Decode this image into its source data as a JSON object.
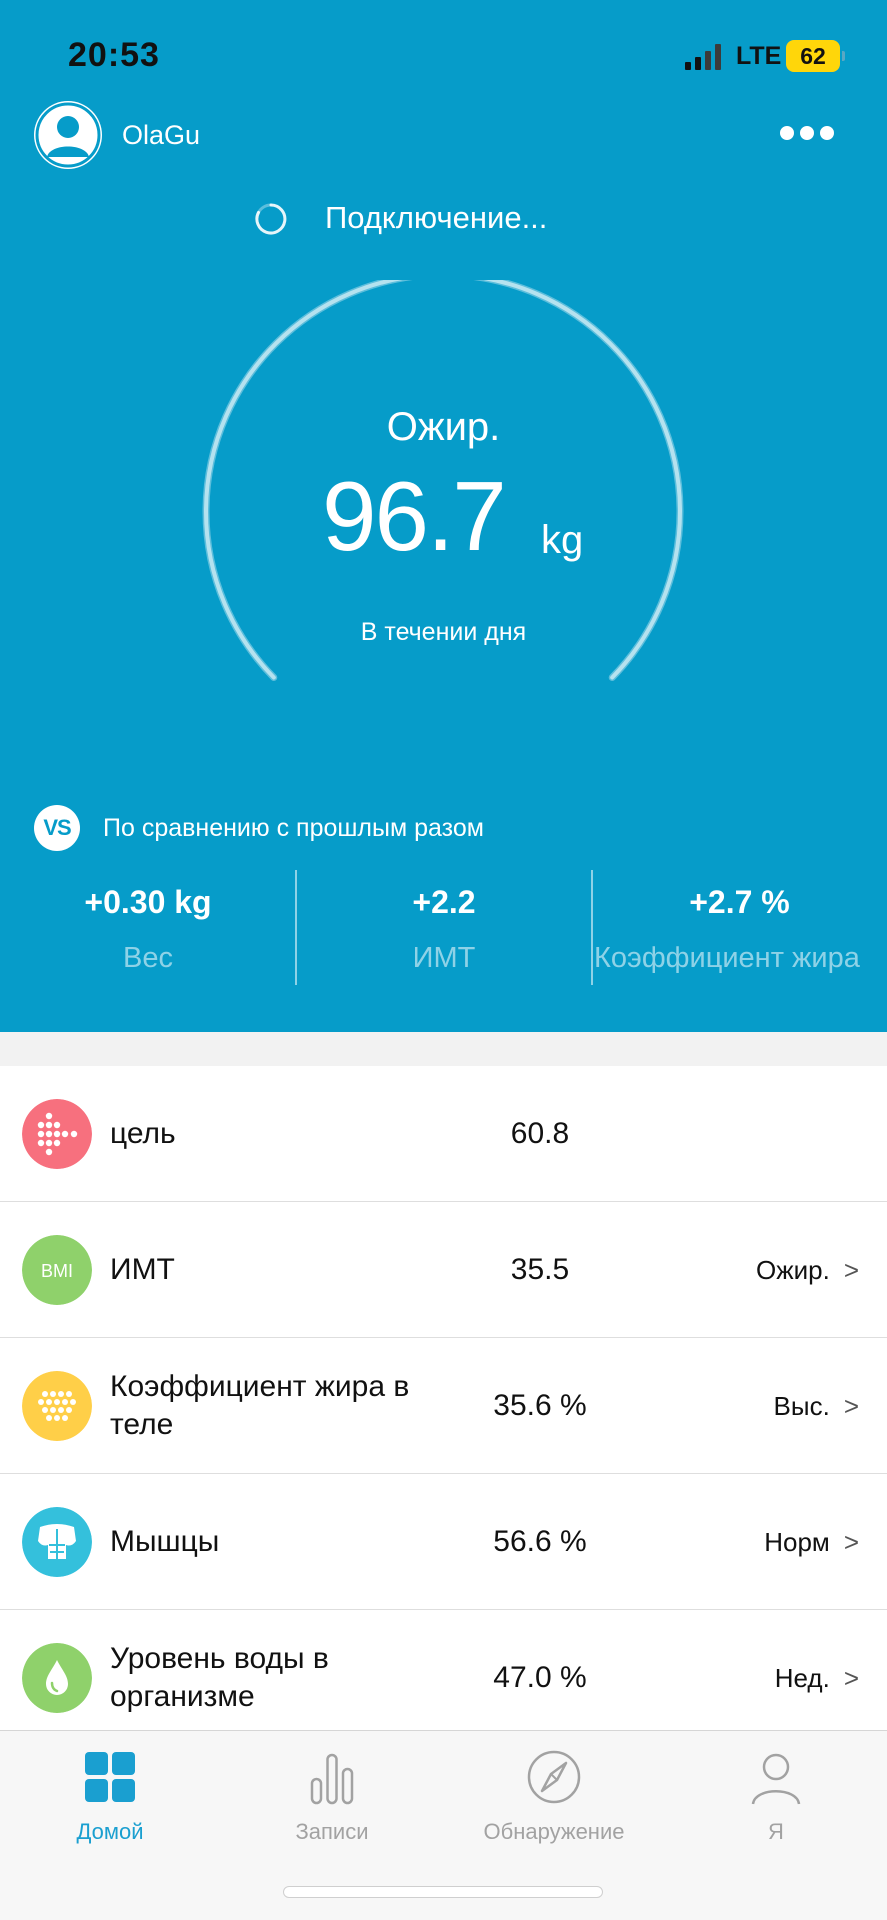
{
  "status_bar": {
    "time": "20:53",
    "network": "LTE",
    "battery": "62"
  },
  "header": {
    "username": "OlaGu",
    "connection_status": "Подключение..."
  },
  "gauge": {
    "status": "Ожир.",
    "value": "96.7",
    "unit": "kg",
    "period": "В течении дня"
  },
  "comparison": {
    "label": "По сравнению с прошлым разом",
    "badge": "VS",
    "items": [
      {
        "value": "+0.30 kg",
        "label": "Вес"
      },
      {
        "value": "+2.2",
        "label": "ИМТ"
      },
      {
        "value": "+2.7 %",
        "label": "Коэффициент жира"
      }
    ]
  },
  "metrics": [
    {
      "name": "цель",
      "value": "60.8",
      "status": "",
      "icon": "goal-icon",
      "color": "#f7707e"
    },
    {
      "name": "ИМТ",
      "value": "35.5",
      "status": "Ожир.",
      "icon": "bmi-icon",
      "icon_text": "BMI",
      "color": "#8fd16b"
    },
    {
      "name": "Коэффициент жира в теле",
      "value": "35.6 %",
      "status": "Выс.",
      "icon": "body-fat-icon",
      "color": "#ffcf48"
    },
    {
      "name": "Мышцы",
      "value": "56.6 %",
      "status": "Норм",
      "icon": "muscle-icon",
      "color": "#34c0dc"
    },
    {
      "name": "Уровень воды в организме",
      "value": "47.0 %",
      "status": "Нед.",
      "icon": "water-drop-icon",
      "color": "#8fd16b"
    }
  ],
  "tabs": [
    {
      "label": "Домой",
      "icon": "home-grid-icon",
      "active": true
    },
    {
      "label": "Записи",
      "icon": "bar-chart-icon",
      "active": false
    },
    {
      "label": "Обнаружение",
      "icon": "compass-icon",
      "active": false
    },
    {
      "label": "Я",
      "icon": "person-icon",
      "active": false
    }
  ],
  "colors": {
    "header_bg": "#069cc9",
    "accent": "#1a9fd0"
  }
}
